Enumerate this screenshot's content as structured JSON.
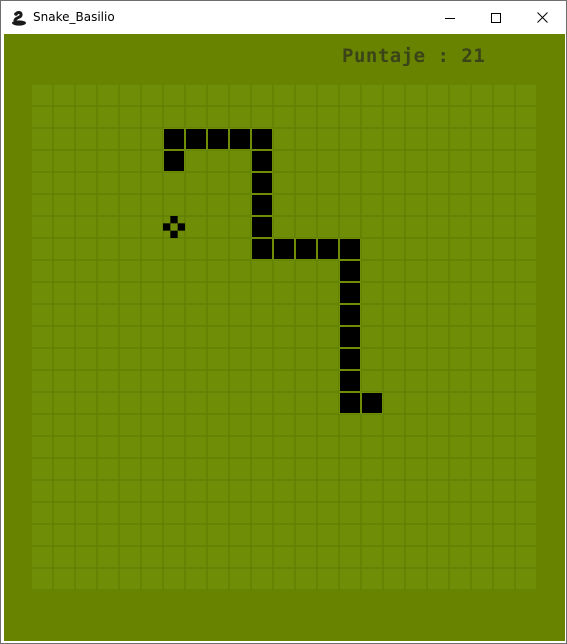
{
  "window": {
    "title": "Snake_Basilio",
    "controls": {
      "minimize": "minimize-icon",
      "maximize": "maximize-icon",
      "close": "close-icon"
    }
  },
  "game": {
    "score_text": "Puntaje : 21",
    "colors": {
      "background": "#678300",
      "board": "#6f8d07",
      "grid": "#5e7b00",
      "snake": "#000000",
      "food": "#000000",
      "score_text": "#3a4418"
    },
    "grid": {
      "columns": 23,
      "rows": 23
    },
    "snake": [
      [
        15,
        14
      ],
      [
        14,
        14
      ],
      [
        14,
        13
      ],
      [
        14,
        12
      ],
      [
        14,
        11
      ],
      [
        14,
        10
      ],
      [
        14,
        9
      ],
      [
        14,
        8
      ],
      [
        13,
        7
      ],
      [
        12,
        7
      ],
      [
        11,
        7
      ],
      [
        10,
        7
      ],
      [
        14,
        7
      ],
      [
        10,
        6
      ],
      [
        10,
        5
      ],
      [
        10,
        4
      ],
      [
        10,
        3
      ],
      [
        10,
        2
      ],
      [
        9,
        2
      ],
      [
        8,
        2
      ],
      [
        7,
        2
      ],
      [
        6,
        2
      ],
      [
        6,
        3
      ]
    ],
    "food": [
      6,
      6
    ]
  }
}
